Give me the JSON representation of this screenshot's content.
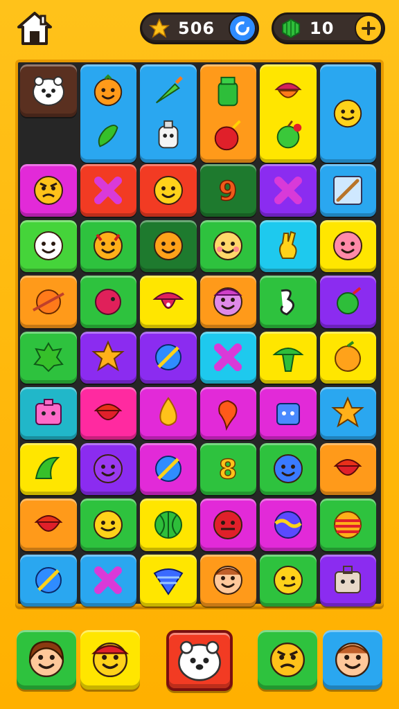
{
  "header": {
    "home_icon": "home-icon",
    "stars": {
      "icon": "star-icon",
      "value": "506",
      "action_icon": "refresh-icon",
      "action_color": "#2f8cff"
    },
    "gems": {
      "icon": "gem-icon",
      "value": "10",
      "action_icon": "plus-icon",
      "action_color": "#ffc21a"
    }
  },
  "colors": {
    "background": "#ffb800",
    "board": "#262626",
    "blue": "#2aa7f0",
    "orange": "#ff9a1a",
    "yellow": "#ffe600",
    "magenta": "#e22ad8",
    "red": "#f23b23",
    "darkgreen": "#1e7a2e",
    "purple": "#8b2cf0",
    "lime": "#45d43a",
    "green": "#2ec23e",
    "teal": "#21b7c9",
    "pink": "#ff2aa0",
    "cyan": "#1ec9ee",
    "brown": "#5a3020"
  },
  "board": {
    "rows": [
      [
        {
          "color": "brown",
          "icons": [
            "white-creature-icon"
          ]
        },
        {
          "color": "blue",
          "icons": [
            "orange-fruit-icon",
            "green-pepper-icon"
          ],
          "tall": true
        },
        {
          "color": "blue",
          "icons": [
            "carrot-icon",
            "ghost-bottle-icon"
          ],
          "tall": true
        },
        {
          "color": "orange",
          "icons": [
            "green-jar-icon",
            "red-bomb-icon"
          ],
          "tall": true
        },
        {
          "color": "yellow",
          "icons": [
            "acorn-icon",
            "green-apple-icon"
          ],
          "tall": true
        },
        {
          "color": "blue",
          "icons": [
            "smiley-face-icon"
          ],
          "tall": true
        }
      ],
      [
        {
          "color": "magenta",
          "icon": "angry-face-icon"
        },
        {
          "color": "red",
          "icon": "candy-cross-icon"
        },
        {
          "color": "red",
          "icon": "happy-face-icon"
        },
        {
          "color": "darkgreen",
          "icon": "number-nine-icon"
        },
        {
          "color": "purple",
          "icon": "candy-cross-icon"
        },
        {
          "color": "blue",
          "icon": "stick-icon"
        }
      ],
      [
        {
          "color": "lime",
          "icon": "baby-face-icon"
        },
        {
          "color": "green",
          "icon": "devil-face-icon"
        },
        {
          "color": "darkgreen",
          "icon": "orange-smiley-icon"
        },
        {
          "color": "green",
          "icon": "blush-face-icon"
        },
        {
          "color": "cyan",
          "icon": "hand-sign-icon"
        },
        {
          "color": "yellow",
          "icon": "pink-face-icon"
        }
      ],
      [
        {
          "color": "orange",
          "icon": "planet-icon"
        },
        {
          "color": "green",
          "icon": "pink-bubble-icon"
        },
        {
          "color": "yellow",
          "icon": "mushroom-icon"
        },
        {
          "color": "orange",
          "icon": "hat-face-icon"
        },
        {
          "color": "green",
          "icon": "white-glyph-icon"
        },
        {
          "color": "purple",
          "icon": "green-bug-icon"
        }
      ],
      [
        {
          "color": "green",
          "icon": "green-splat-icon"
        },
        {
          "color": "purple",
          "icon": "star-icon"
        },
        {
          "color": "purple",
          "icon": "ball-stripe-icon"
        },
        {
          "color": "cyan",
          "icon": "candy-cross-icon"
        },
        {
          "color": "yellow",
          "icon": "green-mushroom-icon"
        },
        {
          "color": "yellow",
          "icon": "peach-icon"
        }
      ],
      [
        {
          "color": "teal",
          "icon": "pink-box-face-icon"
        },
        {
          "color": "pink",
          "icon": "red-acorn-icon"
        },
        {
          "color": "magenta",
          "icon": "flame-icon"
        },
        {
          "color": "magenta",
          "icon": "orange-tadpole-icon"
        },
        {
          "color": "magenta",
          "icon": "robot-face-icon"
        },
        {
          "color": "blue",
          "icon": "star-icon"
        }
      ],
      [
        {
          "color": "yellow",
          "icon": "green-peapod-icon"
        },
        {
          "color": "purple",
          "icon": "purple-face-icon"
        },
        {
          "color": "magenta",
          "icon": "ball-stripe-icon"
        },
        {
          "color": "green",
          "icon": "number-eight-icon"
        },
        {
          "color": "green",
          "icon": "blue-face-icon"
        },
        {
          "color": "orange",
          "icon": "red-acorn-icon"
        }
      ],
      [
        {
          "color": "orange",
          "icon": "red-acorn-icon"
        },
        {
          "color": "green",
          "icon": "wink-face-icon"
        },
        {
          "color": "yellow",
          "icon": "melon-icon"
        },
        {
          "color": "magenta",
          "icon": "red-face-icon"
        },
        {
          "color": "magenta",
          "icon": "wave-ball-icon"
        },
        {
          "color": "green",
          "icon": "striped-ball-icon"
        }
      ],
      [
        {
          "color": "blue",
          "icon": "ball-stripe-icon"
        },
        {
          "color": "blue",
          "icon": "candy-cross-icon"
        },
        {
          "color": "yellow",
          "icon": "striped-top-icon"
        },
        {
          "color": "orange",
          "icon": "boy-face-icon"
        },
        {
          "color": "green",
          "icon": "smirk-face-icon"
        },
        {
          "color": "purple",
          "icon": "bag-face-icon"
        }
      ]
    ]
  },
  "dock": [
    {
      "color": "green",
      "icon": "girl-face-icon"
    },
    {
      "color": "yellow",
      "icon": "red-hat-face-icon"
    },
    {
      "color": "red",
      "icon": "white-creature-icon",
      "center": true
    },
    {
      "color": "green",
      "icon": "angry-face-icon"
    },
    {
      "color": "blue",
      "icon": "boy-face-icon"
    }
  ]
}
